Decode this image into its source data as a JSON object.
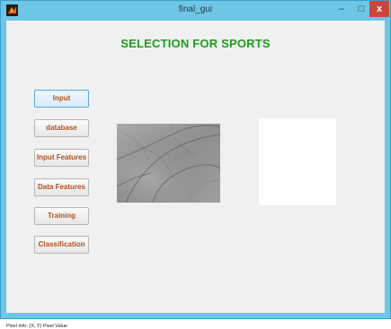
{
  "window": {
    "title": "final_gui",
    "minimize_glyph": "–",
    "maximize_glyph": "□",
    "close_glyph": "x",
    "app_icon": "matlab-icon"
  },
  "heading": "SELECTION FOR SPORTS",
  "buttons": [
    {
      "label": "Input",
      "active": true
    },
    {
      "label": "database"
    },
    {
      "label": "Input Features"
    },
    {
      "label": "Data Features"
    },
    {
      "label": "Training"
    },
    {
      "label": "Classification"
    }
  ],
  "status_text": "Pixel info: (X, Y)  Pixel Value",
  "colors": {
    "title_bar": "#6ec6e6",
    "heading": "#1f9a1f",
    "button_text": "#b0521f",
    "close_button": "#c9463d"
  }
}
